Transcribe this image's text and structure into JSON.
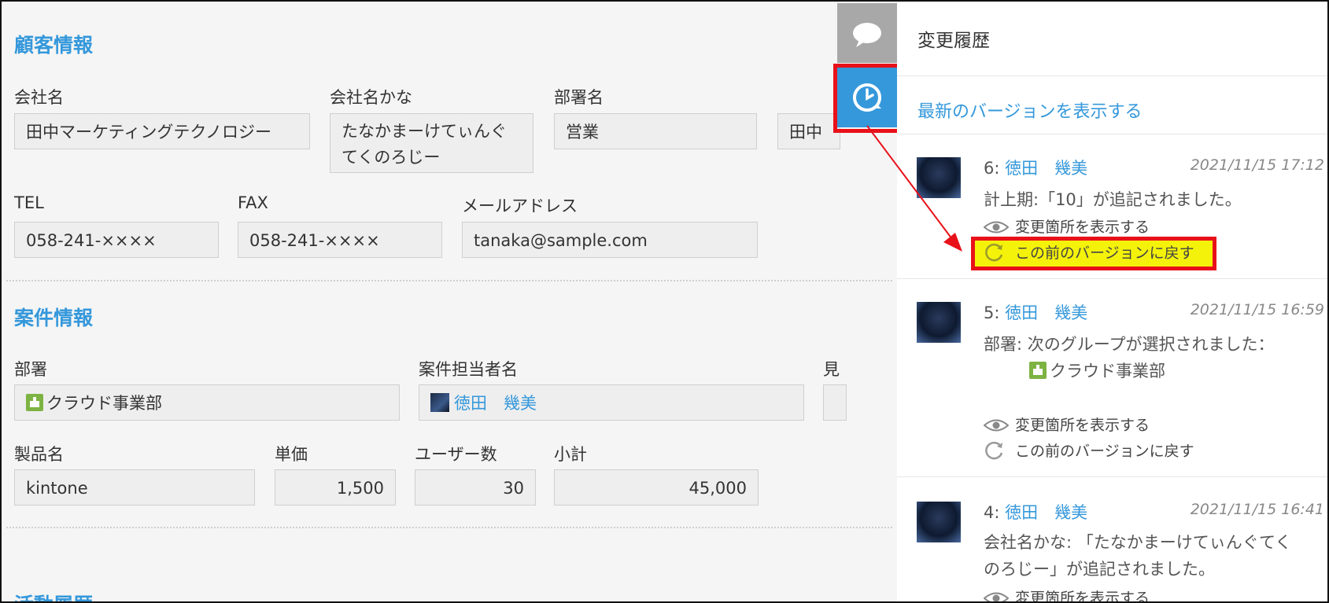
{
  "customer": {
    "section_title": "顧客情報",
    "company_label": "会社名",
    "company_value": "田中マーケティングテクノロジー",
    "kana_label": "会社名かな",
    "kana_value": "たなかまーけてぃんぐてくのろじー",
    "dept_label": "部署名",
    "dept_value": "営業",
    "contact_partial_value": "田中",
    "tel_label": "TEL",
    "tel_value": "058-241-××××",
    "fax_label": "FAX",
    "fax_value": "058-241-××××",
    "email_label": "メールアドレス",
    "email_value": "tanaka@sample.com"
  },
  "deal": {
    "section_title": "案件情報",
    "dept_label": "部署",
    "dept_value": "クラウド事業部",
    "owner_label": "案件担当者名",
    "owner_value": "徳田　幾美",
    "partial_label": "見",
    "product_label": "製品名",
    "product_value": "kintone",
    "price_label": "単価",
    "price_value": "1,500",
    "users_label": "ユーザー数",
    "users_value": "30",
    "subtotal_label": "小計",
    "subtotal_value": "45,000"
  },
  "activity": {
    "section_title": "活動履歴"
  },
  "history_panel": {
    "title": "変更履歴",
    "latest_link": "最新のバージョンを表示する",
    "show_changes_label": "変更箇所を表示する",
    "revert_label": "この前のバージョンに戻す",
    "entries": [
      {
        "version": "6:",
        "user": "徳田　幾美",
        "time": "2021/11/15 17:12",
        "desc": "計上期:「10」が追記されました。"
      },
      {
        "version": "5:",
        "user": "徳田　幾美",
        "time": "2021/11/15 16:59",
        "desc": "部署: 次のグループが選択されました：",
        "desc2": "クラウド事業部"
      },
      {
        "version": "4:",
        "user": "徳田　幾美",
        "time": "2021/11/15 16:41",
        "desc": "会社名かな: 「たなかまーけてぃんぐてく",
        "desc2": "のろじー」が追記されました。"
      }
    ]
  },
  "colors": {
    "accent": "#3498db",
    "highlight_border": "#e8111a",
    "highlight_fill": "#f4f20a"
  }
}
